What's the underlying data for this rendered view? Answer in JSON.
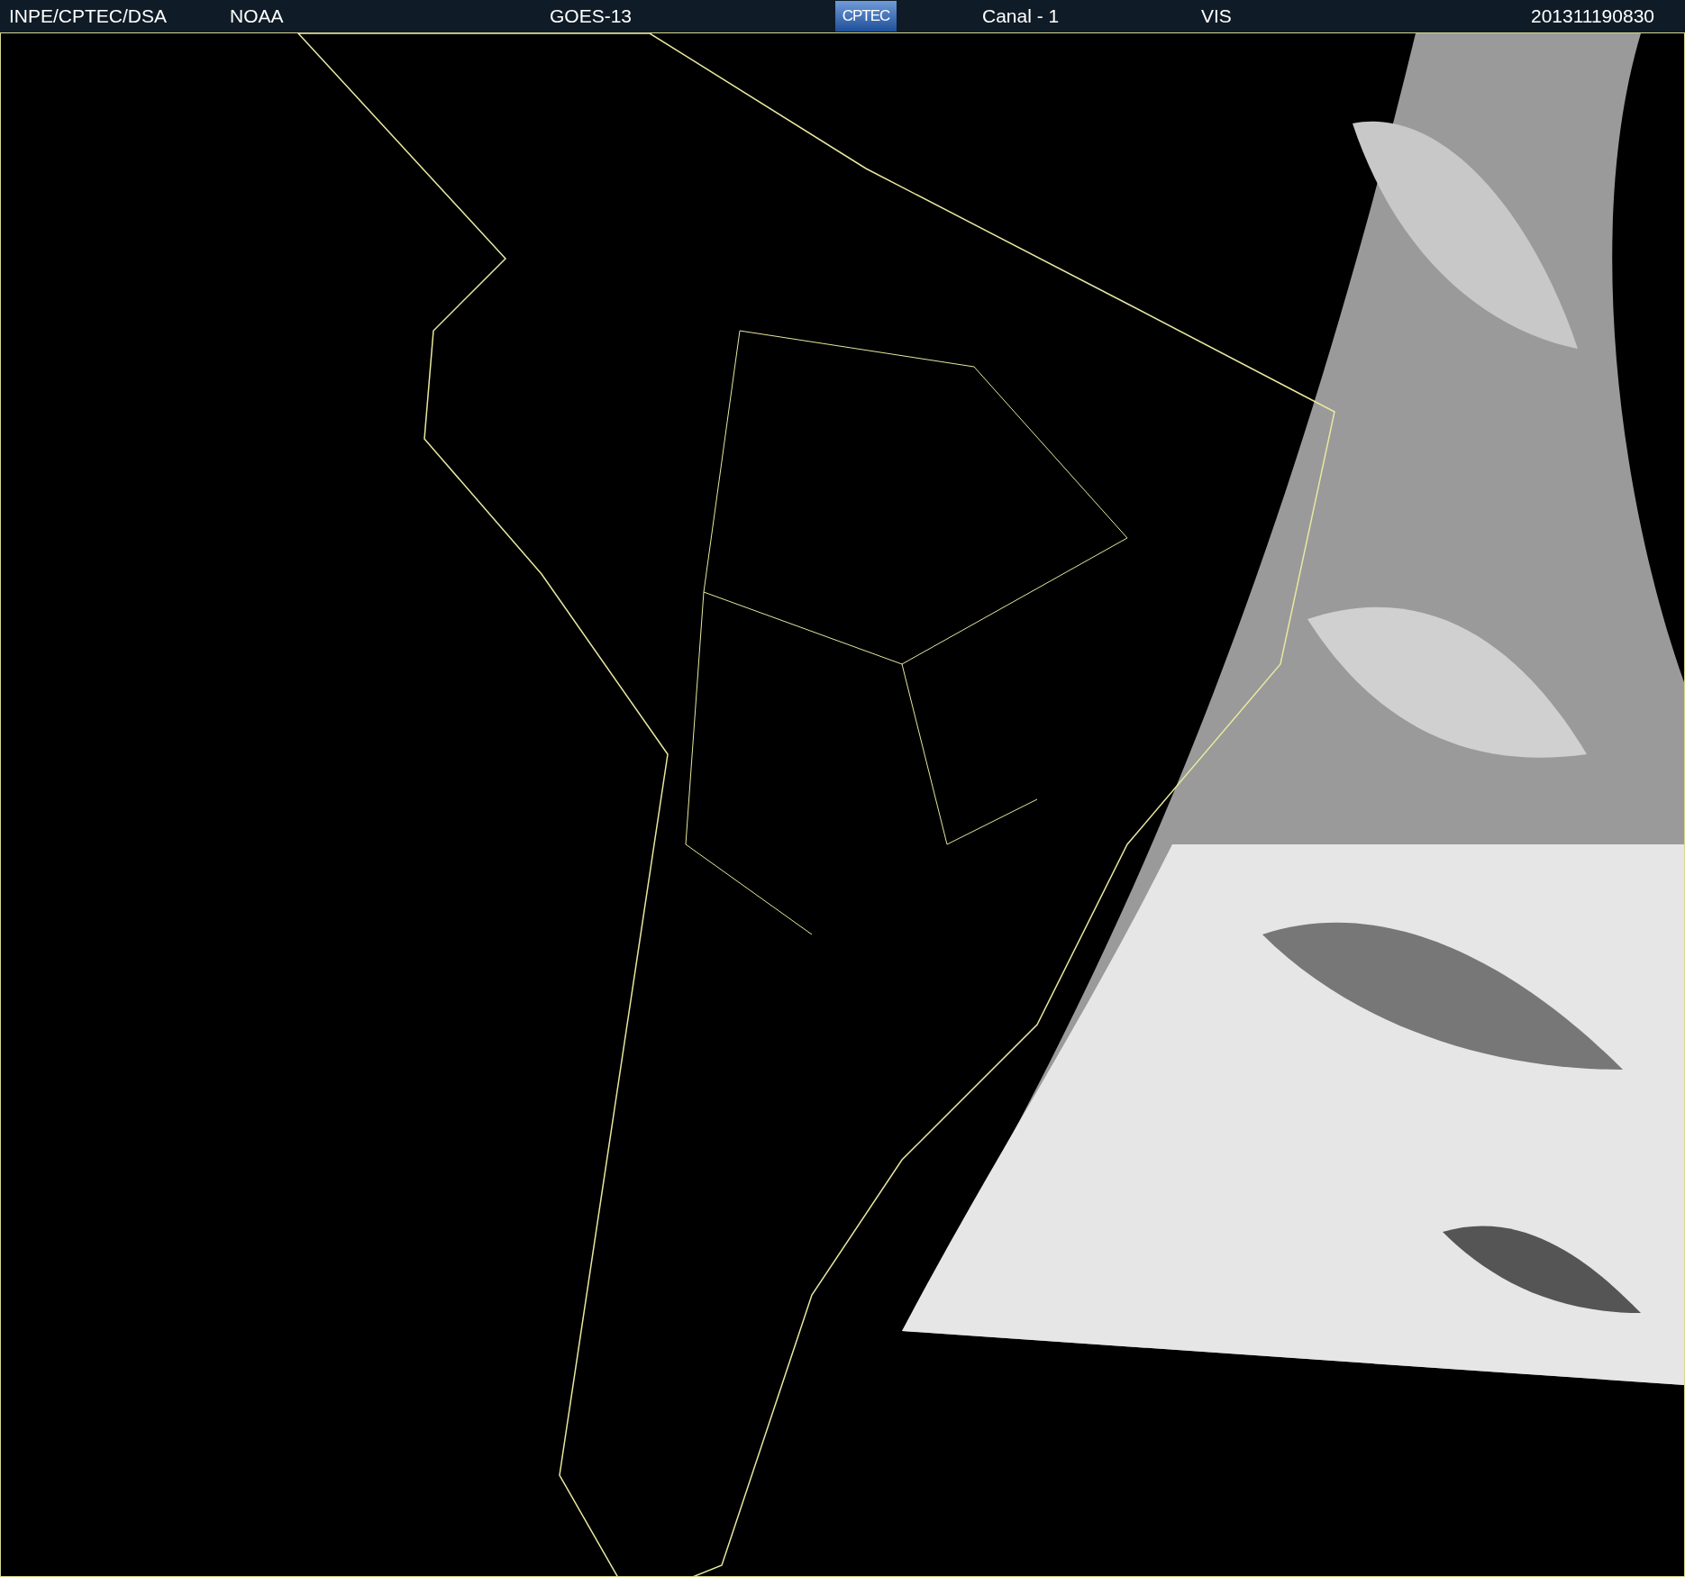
{
  "header": {
    "source": "INPE/CPTEC/DSA",
    "agency": "NOAA",
    "satellite": "GOES-13",
    "logo": "CPTEC",
    "channel": "Canal - 1",
    "band": "VIS",
    "timestamp": "201311190830"
  }
}
